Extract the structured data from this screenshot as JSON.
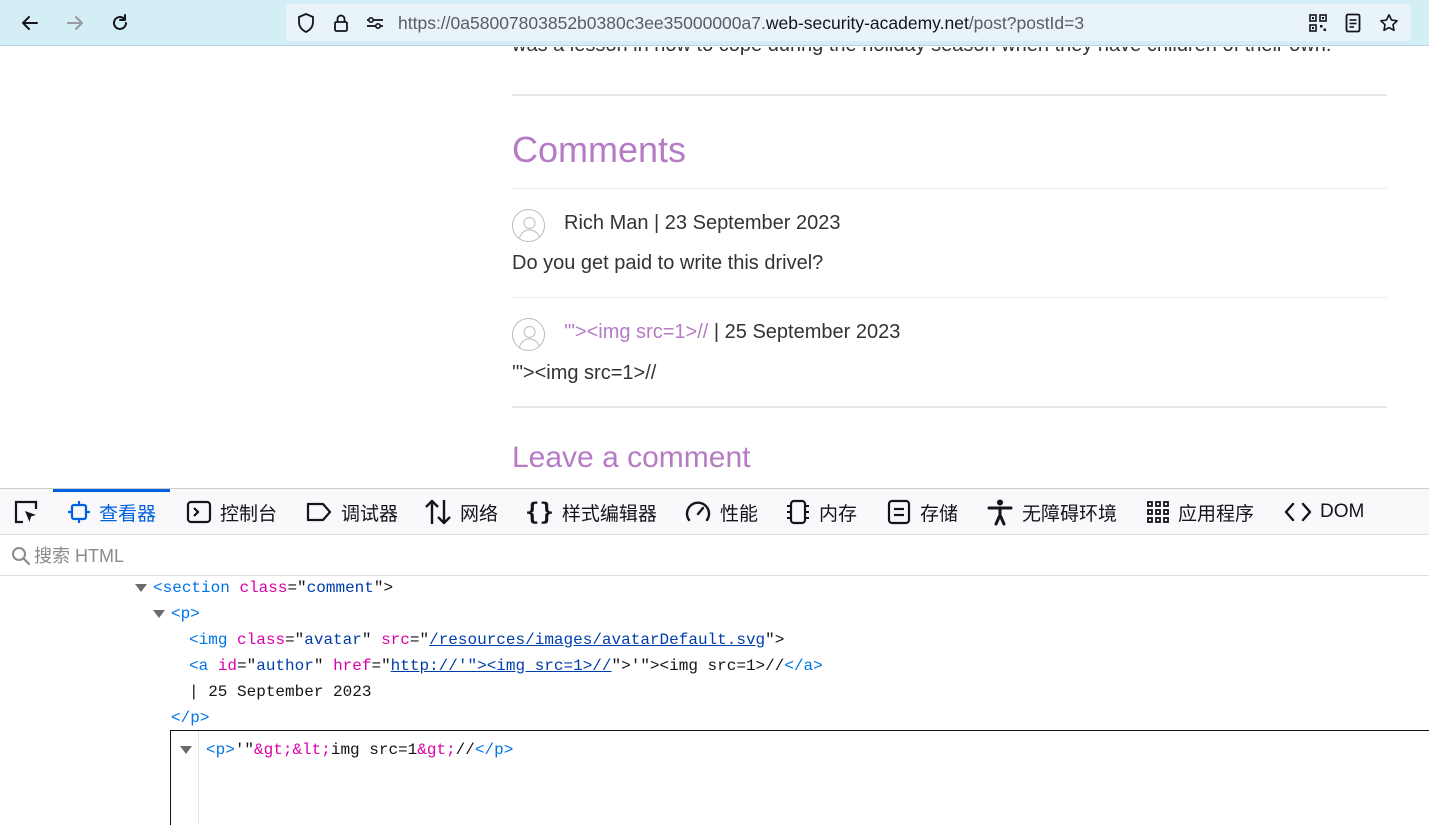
{
  "browser": {
    "url_prefix": "https://0a58007803852b0380c3ee35000000a7.",
    "url_domain": "web-security-academy.net",
    "url_path": "/post?postId=3"
  },
  "page": {
    "cut_text": "was a lesson in how to cope during the holiday season when they have children of their own.",
    "comments_heading": "Comments",
    "comments": [
      {
        "author": "Rich Man",
        "separator": " | ",
        "date": "23 September 2023",
        "text": "Do you get paid to write this drivel?"
      },
      {
        "author": "'\"><img src=1>//",
        "separator": " | ",
        "date": "25 September 2023",
        "text": "'\"><img src=1>//"
      }
    ],
    "leave_heading": "Leave a comment"
  },
  "devtools": {
    "tabs": [
      {
        "label": "查看器",
        "icon": "inspector-icon"
      },
      {
        "label": "控制台",
        "icon": "console-icon"
      },
      {
        "label": "调试器",
        "icon": "debugger-icon"
      },
      {
        "label": "网络",
        "icon": "network-icon"
      },
      {
        "label": "样式编辑器",
        "icon": "style-editor-icon"
      },
      {
        "label": "性能",
        "icon": "performance-icon"
      },
      {
        "label": "内存",
        "icon": "memory-icon"
      },
      {
        "label": "存储",
        "icon": "storage-icon"
      },
      {
        "label": "无障碍环境",
        "icon": "accessibility-icon"
      },
      {
        "label": "应用程序",
        "icon": "application-icon"
      },
      {
        "label": "DOM",
        "icon": "dom-icon"
      }
    ],
    "search_placeholder": "搜索 HTML",
    "tree": {
      "l1_open": "<",
      "l1_tag": "section",
      "l1_attr": "class",
      "l1_eq": "=\"",
      "l1_val": "comment",
      "l1_close": "\">",
      "l2_open": "<",
      "l2_tag": "p",
      "l2_close": ">",
      "l3_open": "<",
      "l3_tag": "img",
      "l3_attr1": "class",
      "l3_eq1": "=\"",
      "l3_val1": "avatar",
      "l3_q1": "\"",
      "l3_attr2": "src",
      "l3_eq2": "=\"",
      "l3_val2": "/resources/images/avatarDefault.svg",
      "l3_close": "\">",
      "l4_open": "<",
      "l4_tag": "a",
      "l4_attr1": "id",
      "l4_eq1": "=\"",
      "l4_val1": "author",
      "l4_q1": "\"",
      "l4_attr2": "href",
      "l4_eq2": "=\"",
      "l4_val2": "http://'\"><img src=1>//",
      "l4_close": "\">",
      "l4_text": "'\"><img src=1>//",
      "l4_end_open": "</",
      "l4_end_tag": "a",
      "l4_end_close": ">",
      "l5_text": "| 25 September 2023",
      "l6_open": "</",
      "l6_tag": "p",
      "l6_close": ">",
      "l7_open": "<",
      "l7_tag": "p",
      "l7_close": ">",
      "l7_text1": "'\"",
      "l7_ent1": "&gt;&lt;",
      "l7_text2": "img src=1",
      "l7_ent2": "&gt;",
      "l7_text3": "//",
      "l7_end": "</",
      "l7_end_tag": "p",
      "l7_end_close": ">"
    }
  }
}
